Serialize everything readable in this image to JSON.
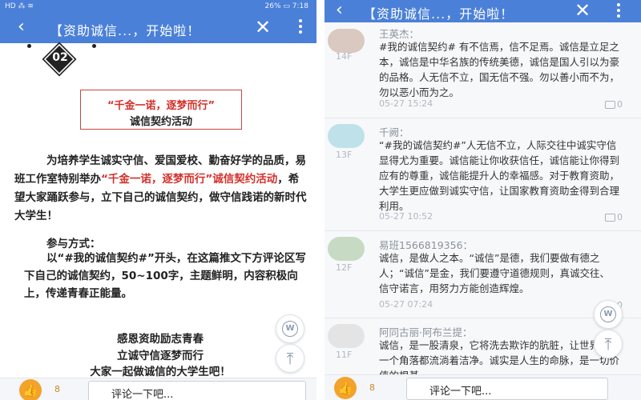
{
  "status_bar": {
    "left_text": "HD ⁂ ≋",
    "right_text": "26% ▭ 7:18"
  },
  "header": {
    "title": "【资助诚信...，开始啦！",
    "back_icon": "‹",
    "close_icon": "✕"
  },
  "article": {
    "badge_number": "02",
    "box_title": "“千金一诺，逐梦而行”",
    "box_subtitle": "诚信契约活动",
    "paragraph_part1": "为培养学生诚实守信、爱国爱校、勤奋好学的品质，易班工作室特别举办",
    "paragraph_highlight": "“千金一诺，逐梦而行”诚信契约活动",
    "paragraph_part2": "，希望大家踊跃参与，立下自己的诚信契约，做守信践诺的新时代大学生！",
    "participation_heading": "参与方式：",
    "participation_text": "以“#我的诚信契约#”开头，在这篇推文下方评论区写下自己的诚信契约，50~100字，主题鲜明，内容积极向上，传递青春正能量。",
    "slogan_1": "感恩资助励志青春",
    "slogan_2": "立诚守信逐梦而行",
    "slogan_3": "大家一起做诚信的大学生吧！"
  },
  "bottom_bar": {
    "like_count": "8",
    "comment_placeholder": "评论一下吧..."
  },
  "comments": [
    {
      "floor": "14F",
      "name": "王英杰：",
      "text": "#我的诚信契约# 有不信焉，信不足焉。诚信是立足之本，诚信是中华名族的传统美德，诚信是国人引以为豪的品格。人无信不立，国无信不强。勿以善小而不为，勿以恶小而为之。",
      "time": "05-27 15:24",
      "replies": "0"
    },
    {
      "floor": "13F",
      "name": "千阙：",
      "text": "“#我的诚信契约#”人无信不立，人际交往中诚实守信显得尤为重要。诚信能让你收获信任，诚信能让你得到应有的尊重，诚信能提升人的幸福感。对于教育资助，大学生更应做到诚实守信，让国家教育资助金得到合理利用。",
      "time": "05-27 10:52",
      "replies": "0"
    },
    {
      "floor": "12F",
      "name": "易班1566819356：",
      "text": "诚信，是做人之本。“诚信”是德，我们要做有德之人；“诚信”是金，我们要遵守道德规则，真诚交往、信守诺言，用努力方能创造辉煌。",
      "time": "05-27 07:24",
      "replies": "0"
    },
    {
      "floor": "11F",
      "name": "阿同古丽·阿布兰提：",
      "text": "诚信，是一股清泉，它将洗去欺诈的肮脏，让世界的每一个角落都流淌着洁净。诚实是人生的命脉，是一切价值的根基。",
      "time": "",
      "replies": ""
    }
  ]
}
